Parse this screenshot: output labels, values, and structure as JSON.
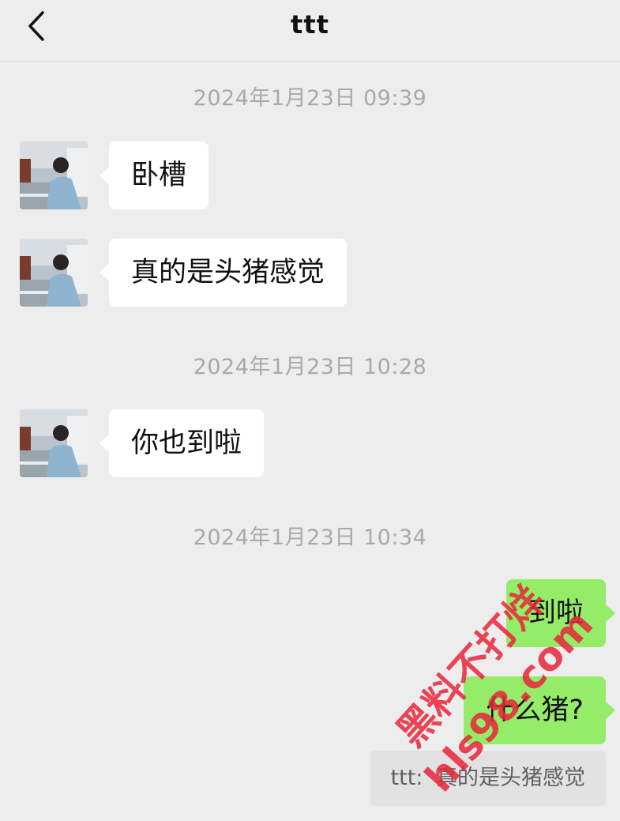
{
  "header": {
    "title": "ttt"
  },
  "messages": {
    "ts1": "2024年1月23日 09:39",
    "msg1": "卧槽",
    "msg2": "真的是头猪感觉",
    "ts2": "2024年1月23日 10:28",
    "msg3": "你也到啦",
    "ts3": "2024年1月23日 10:34",
    "msg4": "到啦",
    "msg5": "什么猪?",
    "quote_sender": "ttt:",
    "quote_text": "真的是头猪感觉"
  },
  "watermark": {
    "line1": "黑料不打烊",
    "line2": "hls98.com"
  },
  "colors": {
    "background": "#ededed",
    "incoming_bubble": "#ffffff",
    "outgoing_bubble": "#95ec69",
    "timestamp": "#a9a9a9",
    "watermark": "#e8253a"
  },
  "icons": {
    "back": "chevron-left-icon",
    "avatar": "contact-avatar-photo"
  }
}
